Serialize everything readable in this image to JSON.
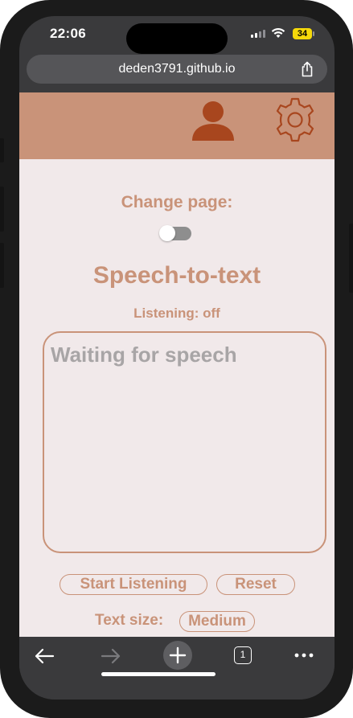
{
  "status_bar": {
    "time": "22:06",
    "battery": "34"
  },
  "browser": {
    "url": "deden3791.github.io"
  },
  "header": {
    "user_icon": "user-icon",
    "settings_icon": "gear-icon"
  },
  "main": {
    "change_page_label": "Change page:",
    "toggle_state": "off",
    "title": "Speech-to-text",
    "listening_status": "Listening: off",
    "speech_placeholder": "Waiting for speech",
    "start_button": "Start Listening",
    "reset_button": "Reset",
    "text_size_label": "Text size:",
    "text_size_value": "Medium"
  },
  "toolbar": {
    "back_icon": "arrow-left-icon",
    "forward_icon": "arrow-right-icon",
    "new_tab_icon": "plus-icon",
    "tab_count": "1",
    "more_icon": "more-icon"
  },
  "colors": {
    "accent": "#c99379",
    "background": "#f1e9ea",
    "icon_dark": "#a8461e",
    "placeholder": "#a8a5a6"
  }
}
